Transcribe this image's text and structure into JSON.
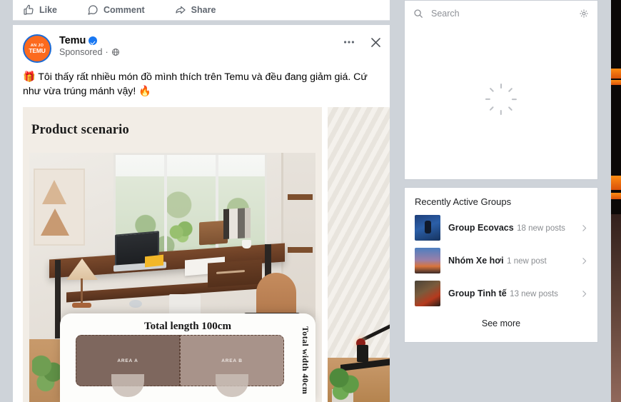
{
  "feed": {
    "action_bar": {
      "like": "Like",
      "comment": "Comment",
      "share": "Share"
    },
    "post": {
      "author": "Temu",
      "sponsored_label": "Sponsored",
      "separator": "·",
      "audience_icon": "globe-icon",
      "avatar_text_top": "AN JO",
      "avatar_text_bottom": "TEMU",
      "verified": true,
      "text": "🎁 Tôi thấy rất nhiều món đồ mình thích trên Temu và đều đang giảm giá. Cứ như vừa trúng mánh vậy! 🔥",
      "menu_icon": "ellipsis-icon",
      "close_icon": "close-icon"
    },
    "media": {
      "scenario_title": "Product scenario",
      "dimension": {
        "total_length": "Total length 100cm",
        "total_width": "Total width 40cm",
        "area_a": "AREA A",
        "area_b": "AREA B"
      }
    }
  },
  "sidebar": {
    "search": {
      "placeholder": "Search",
      "value": "",
      "search_icon": "search-icon",
      "settings_icon": "gear-icon",
      "loading": true
    },
    "groups": {
      "title": "Recently Active Groups",
      "items": [
        {
          "name": "Group Ecovacs",
          "meta": "18 new posts",
          "chevron": "chevron-right-icon"
        },
        {
          "name": "Nhóm Xe hơi",
          "meta": "1 new post",
          "chevron": "chevron-right-icon"
        },
        {
          "name": "Group Tinh tế",
          "meta": "13 new posts",
          "chevron": "chevron-right-icon"
        }
      ],
      "see_more": "See more"
    }
  },
  "colors": {
    "page_background": "#ced3d9",
    "card_background": "#ffffff",
    "brand_temu": "#fc6a1e",
    "verified_blue": "#1877f2",
    "primary_text": "#050505",
    "secondary_text": "#65676b"
  }
}
